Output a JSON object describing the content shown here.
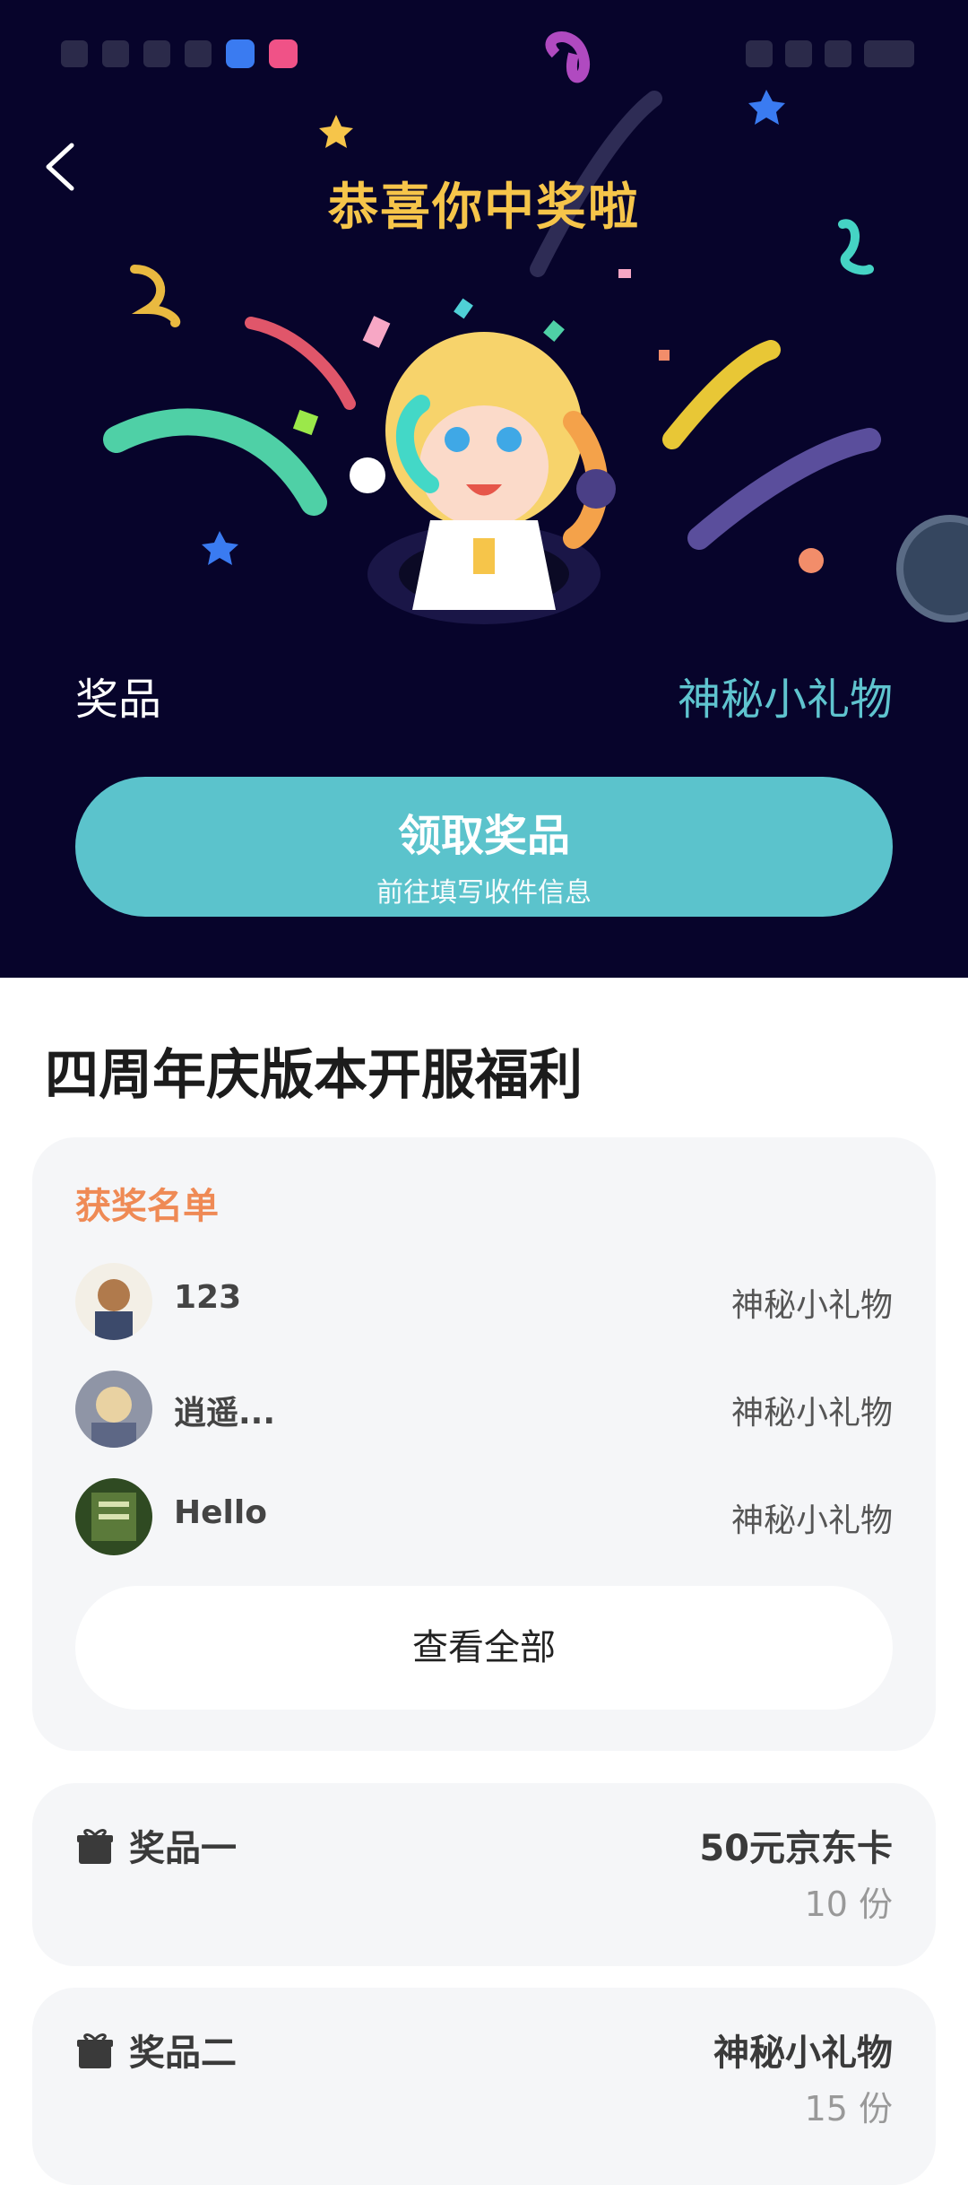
{
  "hero": {
    "title": "恭喜你中奖啦",
    "prize_label": "奖品",
    "prize_value": "神秘小礼物",
    "claim_button": {
      "label": "领取奖品",
      "sublabel": "前往填写收件信息"
    }
  },
  "event": {
    "title": "四周年庆版本开服福利"
  },
  "winners": {
    "heading": "获奖名单",
    "items": [
      {
        "name": "123",
        "prize": "神秘小礼物"
      },
      {
        "name": "逍遥...",
        "prize": "神秘小礼物"
      },
      {
        "name": "Hello",
        "prize": "神秘小礼物"
      }
    ],
    "view_all_label": "查看全部"
  },
  "prizes": [
    {
      "name": "奖品一",
      "desc": "50元京东卡",
      "qty": "10 份"
    },
    {
      "name": "奖品二",
      "desc": "神秘小礼物",
      "qty": "15 份"
    }
  ],
  "colors": {
    "hero_bg": "#07042b",
    "accent": "#5bc3cc",
    "title_gold": "#f6c54a",
    "winners_head": "#ef8a55"
  }
}
